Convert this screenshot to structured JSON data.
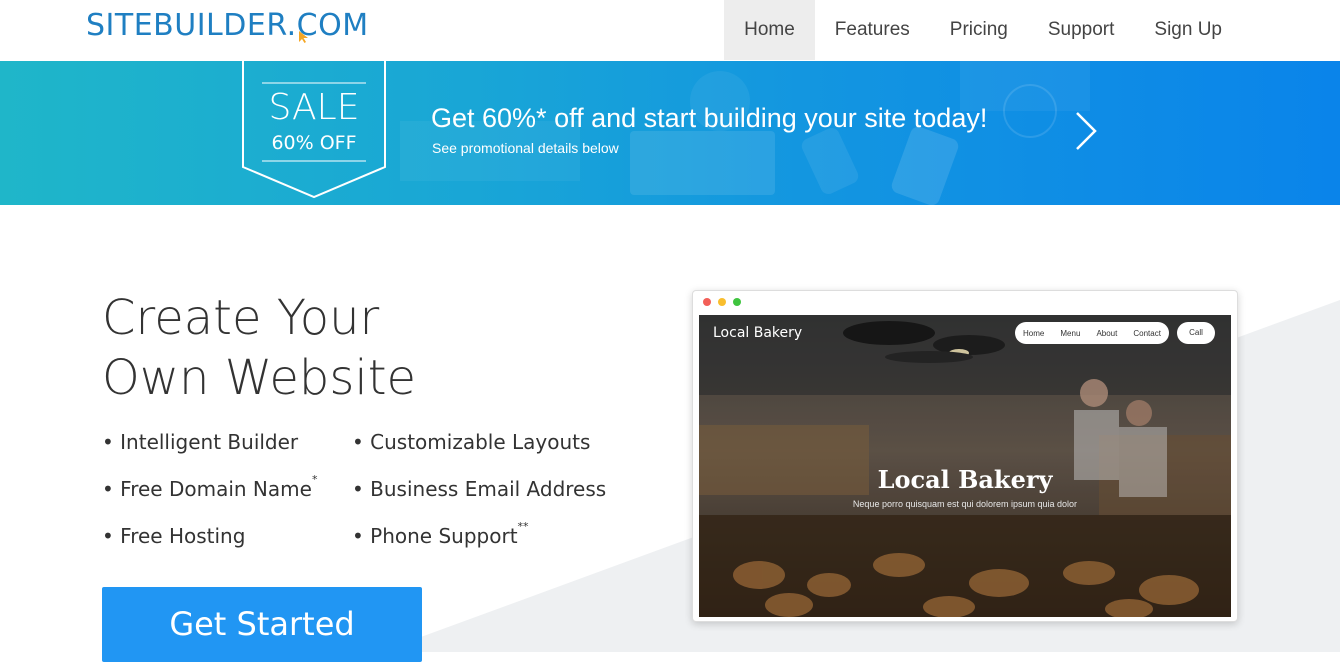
{
  "header": {
    "logo": "SITEBUILDER.COM",
    "nav": [
      "Home",
      "Features",
      "Pricing",
      "Support",
      "Sign Up"
    ],
    "active": "Home"
  },
  "banner": {
    "badge_title": "SALE",
    "badge_sub": "60% OFF",
    "headline": "Get 60%* off and start building your site today!",
    "subtext": "See promotional details below"
  },
  "hero": {
    "title_line1": "Create Your",
    "title_line2": "Own Website",
    "features": [
      {
        "label": "Intelligent Builder",
        "mark": ""
      },
      {
        "label": "Customizable Layouts",
        "mark": ""
      },
      {
        "label": "Free Domain Name",
        "mark": "*"
      },
      {
        "label": "Business Email Address",
        "mark": ""
      },
      {
        "label": "Free Hosting",
        "mark": ""
      },
      {
        "label": "Phone Support",
        "mark": "**"
      }
    ],
    "cta": "Get Started"
  },
  "preview": {
    "brand": "Local Bakery",
    "nav": [
      "Home",
      "Menu",
      "About",
      "Contact"
    ],
    "call": "Call",
    "title": "Local Bakery",
    "subtitle": "Neque porro quisquam est qui dolorem ipsum quia dolor"
  },
  "colors": {
    "logo": "#1f7fc2",
    "cursor": "#f5a623",
    "cta": "#2196f3",
    "banner_start": "#1fb6c9",
    "banner_end": "#0a84ea"
  }
}
